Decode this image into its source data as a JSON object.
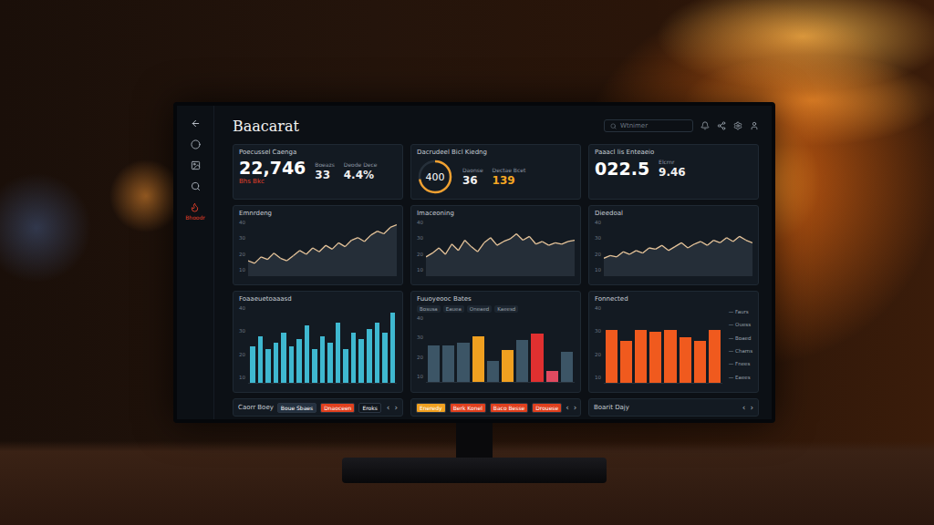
{
  "app": {
    "title": "Baacarat"
  },
  "search": {
    "placeholder": "Wtnimer"
  },
  "sidebar": {
    "items": [
      {
        "selected": false
      },
      {
        "selected": false
      },
      {
        "selected": false
      },
      {
        "selected": true
      }
    ],
    "caption": "Bhoodr"
  },
  "stats": [
    {
      "kind": "number",
      "title": "Poecussel Caenga",
      "value": "22,746",
      "note": "Bhs Bkc",
      "level": 0,
      "metrics": [
        {
          "label": "Boeazs",
          "value": "33",
          "highlight": false
        },
        {
          "label": "Deode Dece",
          "value": "4.4%",
          "highlight": false
        }
      ]
    },
    {
      "kind": "gauge",
      "title": "Dacrudeel Bicl Kiedng",
      "value": "400",
      "note": "",
      "level": 0.72,
      "metrics": [
        {
          "label": "Daonse",
          "value": "36",
          "highlight": false
        },
        {
          "label": "Dectae Bcet",
          "value": "139",
          "highlight": true
        }
      ]
    },
    {
      "kind": "number",
      "title": "Paaacl lis Enteaeio",
      "value": "022.5",
      "note": "",
      "level": 0,
      "metrics": [
        {
          "label": "Elcrnr",
          "value": "9.46",
          "highlight": false
        }
      ]
    }
  ],
  "line_charts": [
    {
      "title": "Emnrdeng",
      "ticks": [
        "40",
        "30",
        "20",
        "10"
      ],
      "values": [
        12,
        10,
        15,
        13,
        18,
        14,
        12,
        16,
        20,
        17,
        22,
        19,
        24,
        21,
        26,
        23,
        28,
        30,
        27,
        32,
        35,
        33,
        38,
        40
      ]
    },
    {
      "title": "Imaceoning",
      "ticks": [
        "40",
        "30",
        "20",
        "10"
      ],
      "values": [
        15,
        18,
        22,
        17,
        25,
        20,
        28,
        23,
        19,
        26,
        30,
        24,
        27,
        29,
        33,
        28,
        31,
        25,
        27,
        24,
        26,
        25,
        27,
        28
      ]
    },
    {
      "title": "Dieedoal",
      "ticks": [
        "40",
        "30",
        "20",
        "10"
      ],
      "values": [
        14,
        16,
        15,
        19,
        17,
        20,
        18,
        22,
        21,
        24,
        20,
        23,
        26,
        22,
        25,
        27,
        24,
        28,
        26,
        30,
        27,
        31,
        28,
        26
      ]
    }
  ],
  "bar_charts": [
    {
      "title": "Foaaeuetoaaasd",
      "ticks": [
        "40",
        "30",
        "20",
        "10"
      ],
      "legend": [],
      "bars": [
        {
          "value": 22,
          "color": "#3fb8d0"
        },
        {
          "value": 28,
          "color": "#3fb8d0"
        },
        {
          "value": 20,
          "color": "#3fb8d0"
        },
        {
          "value": 24,
          "color": "#3fb8d0"
        },
        {
          "value": 30,
          "color": "#3fb8d0"
        },
        {
          "value": 22,
          "color": "#3fb8d0"
        },
        {
          "value": 26,
          "color": "#3fb8d0"
        },
        {
          "value": 34,
          "color": "#3fb8d0"
        },
        {
          "value": 20,
          "color": "#3fb8d0"
        },
        {
          "value": 28,
          "color": "#3fb8d0"
        },
        {
          "value": 24,
          "color": "#3fb8d0"
        },
        {
          "value": 36,
          "color": "#3fb8d0"
        },
        {
          "value": 20,
          "color": "#3fb8d0"
        },
        {
          "value": 30,
          "color": "#3fb8d0"
        },
        {
          "value": 26,
          "color": "#3fb8d0"
        },
        {
          "value": 32,
          "color": "#3fb8d0"
        },
        {
          "value": 36,
          "color": "#3fb8d0"
        },
        {
          "value": 30,
          "color": "#3fb8d0"
        },
        {
          "value": 42,
          "color": "#3fb8d0"
        }
      ]
    },
    {
      "title": "Fuuoyeooc Bates",
      "ticks": [
        "40",
        "30",
        "20",
        "10"
      ],
      "legend": [
        "Bosusa",
        "Eauea",
        "Oneaed",
        "Kaeesd"
      ],
      "bars": [
        {
          "value": 24,
          "color": "#3c5566"
        },
        {
          "value": 24,
          "color": "#3c5566"
        },
        {
          "value": 26,
          "color": "#3c5566"
        },
        {
          "value": 30,
          "color": "#f0a020"
        },
        {
          "value": 14,
          "color": "#3c5566"
        },
        {
          "value": 21,
          "color": "#f0a020"
        },
        {
          "value": 28,
          "color": "#3c5566"
        },
        {
          "value": 32,
          "color": "#e03030"
        },
        {
          "value": 7,
          "color": "#e04a60"
        },
        {
          "value": 20,
          "color": "#3c5566"
        }
      ]
    },
    {
      "title": "Fonnected",
      "ticks": [
        "40",
        "30",
        "20",
        "10"
      ],
      "legend": [
        "Faurs",
        "Ouess",
        "Boaed",
        "Chams",
        "Fnees",
        "Eaees"
      ],
      "bars": [
        {
          "value": 30,
          "color": "#f05a1e"
        },
        {
          "value": 24,
          "color": "#f05a1e"
        },
        {
          "value": 30,
          "color": "#f05a1e"
        },
        {
          "value": 29,
          "color": "#f05a1e"
        },
        {
          "value": 30,
          "color": "#f05a1e"
        },
        {
          "value": 26,
          "color": "#f05a1e"
        },
        {
          "value": 24,
          "color": "#f05a1e"
        },
        {
          "value": 30,
          "color": "#f05a1e"
        }
      ]
    }
  ],
  "footers": [
    {
      "title": "Caorr Boey",
      "chips": [
        {
          "label": "Boue Sbaes",
          "color": "#243140"
        },
        {
          "label": "Dnaoceen",
          "color": "#e0401e"
        },
        {
          "label": "Eroks",
          "color": "#10161d"
        }
      ],
      "arrows": [
        "‹",
        "›"
      ]
    },
    {
      "title": "",
      "chips": [
        {
          "label": "Eneredy",
          "color": "#f0a020"
        },
        {
          "label": "Berk Konel",
          "color": "#e0401e"
        },
        {
          "label": "Baco Besse",
          "color": "#e0401e"
        },
        {
          "label": "Drouese",
          "color": "#e0401e"
        }
      ],
      "arrows": [
        "‹",
        "›"
      ]
    },
    {
      "title": "Boarit Dajy",
      "chips": [],
      "arrows": [
        "‹",
        "›"
      ]
    }
  ]
}
